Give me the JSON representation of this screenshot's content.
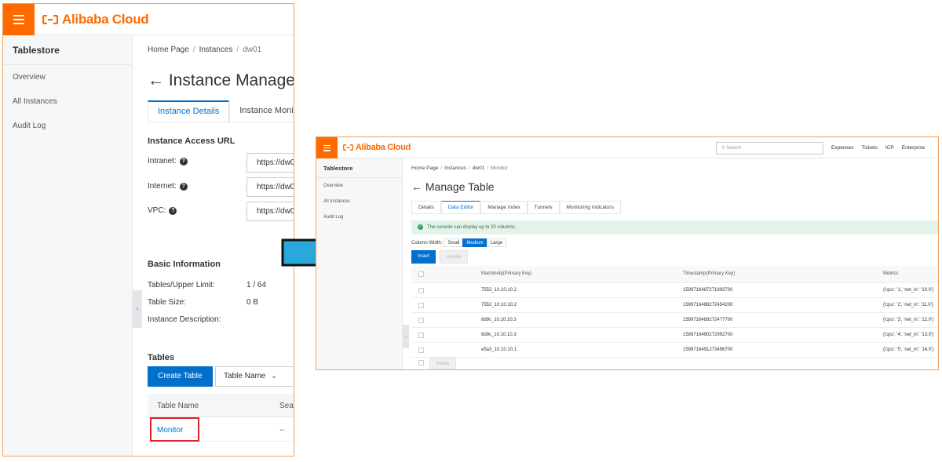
{
  "brand": {
    "name": "Alibaba Cloud",
    "accent": "#ff6a00",
    "link_color": "#0070cc"
  },
  "left": {
    "sidebar": {
      "title": "Tablestore",
      "items": [
        {
          "label": "Overview"
        },
        {
          "label": "All Instances"
        },
        {
          "label": "Audit Log"
        }
      ]
    },
    "breadcrumb": [
      "Home Page",
      "Instances",
      "dw01"
    ],
    "page_title": "Instance Manage",
    "tabs": [
      {
        "label": "Instance Details",
        "active": true
      },
      {
        "label": "Instance Moni",
        "active": false
      }
    ],
    "access_url": {
      "heading": "Instance Access URL",
      "rows": [
        {
          "label": "Intranet:",
          "value": "https://dw0"
        },
        {
          "label": "Internet:",
          "value": "https://dw0"
        },
        {
          "label": "VPC:",
          "value": "https://dw0"
        }
      ]
    },
    "basic_info": {
      "heading": "Basic Information",
      "rows": [
        {
          "label": "Tables/Upper Limit:",
          "value": "1 / 64"
        },
        {
          "label": "Table Size:",
          "value": "0 B"
        },
        {
          "label": "Instance Description:",
          "value": ""
        }
      ]
    },
    "tables": {
      "heading": "Tables",
      "create_button": "Create Table",
      "filter_select": "Table Name",
      "columns": [
        "Table Name",
        "Sear"
      ],
      "rows": [
        {
          "name": "Monitor",
          "col2": "--"
        }
      ]
    }
  },
  "right": {
    "search_placeholder": "Search",
    "nav_links": [
      "Expenses",
      "Tickets",
      "ICP",
      "Enterprise"
    ],
    "sidebar": {
      "title": "Tablestore",
      "items": [
        {
          "label": "Overview"
        },
        {
          "label": "All Instances"
        },
        {
          "label": "Audit Log"
        }
      ]
    },
    "breadcrumb": [
      "Home Page",
      "Instances",
      "dw01",
      "Monitor"
    ],
    "page_title": "Manage Table",
    "tabs": [
      {
        "label": "Details",
        "active": false
      },
      {
        "label": "Data Editor",
        "active": true
      },
      {
        "label": "Manage Index",
        "active": false
      },
      {
        "label": "Tunnels",
        "active": false
      },
      {
        "label": "Monitoring Indicators",
        "active": false
      }
    ],
    "notice": "The console can display up to 20 columns.",
    "column_width": {
      "label": "Column Width:",
      "options": [
        {
          "label": "Small",
          "active": false
        },
        {
          "label": "Medium",
          "active": true
        },
        {
          "label": "Large",
          "active": false
        }
      ]
    },
    "insert_button": "Insert",
    "update_button": "Update",
    "delete_button": "Delete",
    "grid": {
      "columns": [
        "MachineIp(Primary Key)",
        "Timestamp(Primary Key)",
        "Metrics"
      ],
      "rows": [
        {
          "machine": "7552_10.10.10.2",
          "timestamp": "1599716487271893700",
          "metrics": "{'cpu': '1', 'net_in': '10.0'}"
        },
        {
          "machine": "7552_10.10.10.2",
          "timestamp": "1599716488272454200",
          "metrics": "{'cpu': '2', 'net_in': '11.0'}"
        },
        {
          "machine": "8d9c_10.10.10.3",
          "timestamp": "1599716489272477700",
          "metrics": "{'cpu': '3', 'net_in': '12.0'}"
        },
        {
          "machine": "8d9c_10.10.10.3",
          "timestamp": "1599716490272992700",
          "metrics": "{'cpu': '4', 'net_in': '13.0'}"
        },
        {
          "machine": "e5a3_10.10.10.1",
          "timestamp": "1599716491273496700",
          "metrics": "{'cpu': '5', 'net_in': '14.0'}"
        }
      ]
    }
  }
}
